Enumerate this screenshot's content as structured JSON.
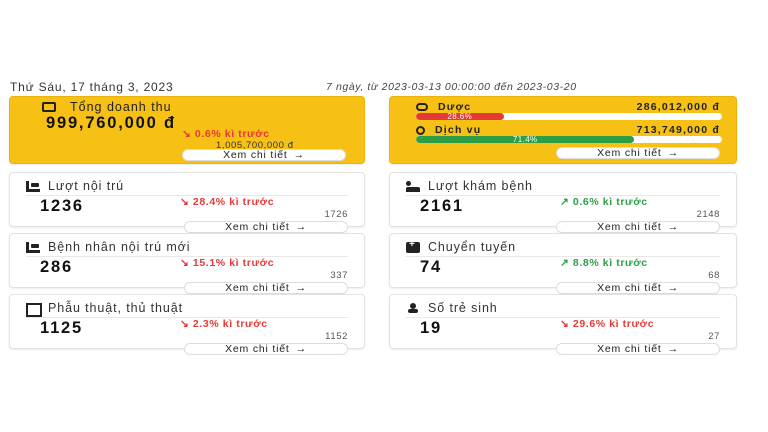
{
  "header": {
    "date": "Thứ Sáu, 17 tháng 3, 2023",
    "range": "7 ngày, từ 2023-03-13 00:00:00 đến 2023-03-20"
  },
  "revenue": {
    "title": "Tổng doanh thu",
    "value": "999,760,000 đ",
    "trend": "0.6% kì trước",
    "prev": "1,005,700,000 đ",
    "button": "Xem chi tiết"
  },
  "breakdown": {
    "duoc": {
      "label": "Dược",
      "value": "286,012,000 đ",
      "percent_text": "28.6%",
      "percent": 28.6,
      "color": "#e53935"
    },
    "dichvu": {
      "label": "Dịch vụ",
      "value": "713,749,000 đ",
      "percent_text": "71.4%",
      "percent": 71.4,
      "color": "#2e9e46"
    },
    "button": "Xem chi tiết"
  },
  "cards": [
    {
      "title": "Lượt nội trú",
      "icon": "bed-icon",
      "value": "1236",
      "trend": "28.4% kì trước",
      "direction": "down",
      "prev": "1726",
      "button": "Xem chi tiết"
    },
    {
      "title": "Lượt khám bệnh",
      "icon": "patients-icon",
      "value": "2161",
      "trend": "0.6% kì trước",
      "direction": "up",
      "prev": "2148",
      "button": "Xem chi tiết"
    },
    {
      "title": "Bệnh nhân nội trú mới",
      "icon": "bed-icon",
      "value": "286",
      "trend": "15.1% kì trước",
      "direction": "down",
      "prev": "337",
      "button": "Xem chi tiết"
    },
    {
      "title": "Chuyển tuyến",
      "icon": "ambulance-icon",
      "value": "74",
      "trend": "8.8% kì trước",
      "direction": "up",
      "prev": "68",
      "button": "Xem chi tiết"
    },
    {
      "title": "Phẫu thuật, thủ thuật",
      "icon": "surgery-icon",
      "value": "1125",
      "trend": "2.3% kì trước",
      "direction": "down",
      "prev": "1152",
      "button": "Xem chi tiết"
    },
    {
      "title": "Số trẻ sinh",
      "icon": "baby-icon",
      "value": "19",
      "trend": "29.6% kì trước",
      "direction": "down",
      "prev": "27",
      "button": "Xem chi tiết"
    }
  ],
  "colors": {
    "accent": "#f6c015",
    "down": "#e53935",
    "up": "#2e9e46"
  }
}
